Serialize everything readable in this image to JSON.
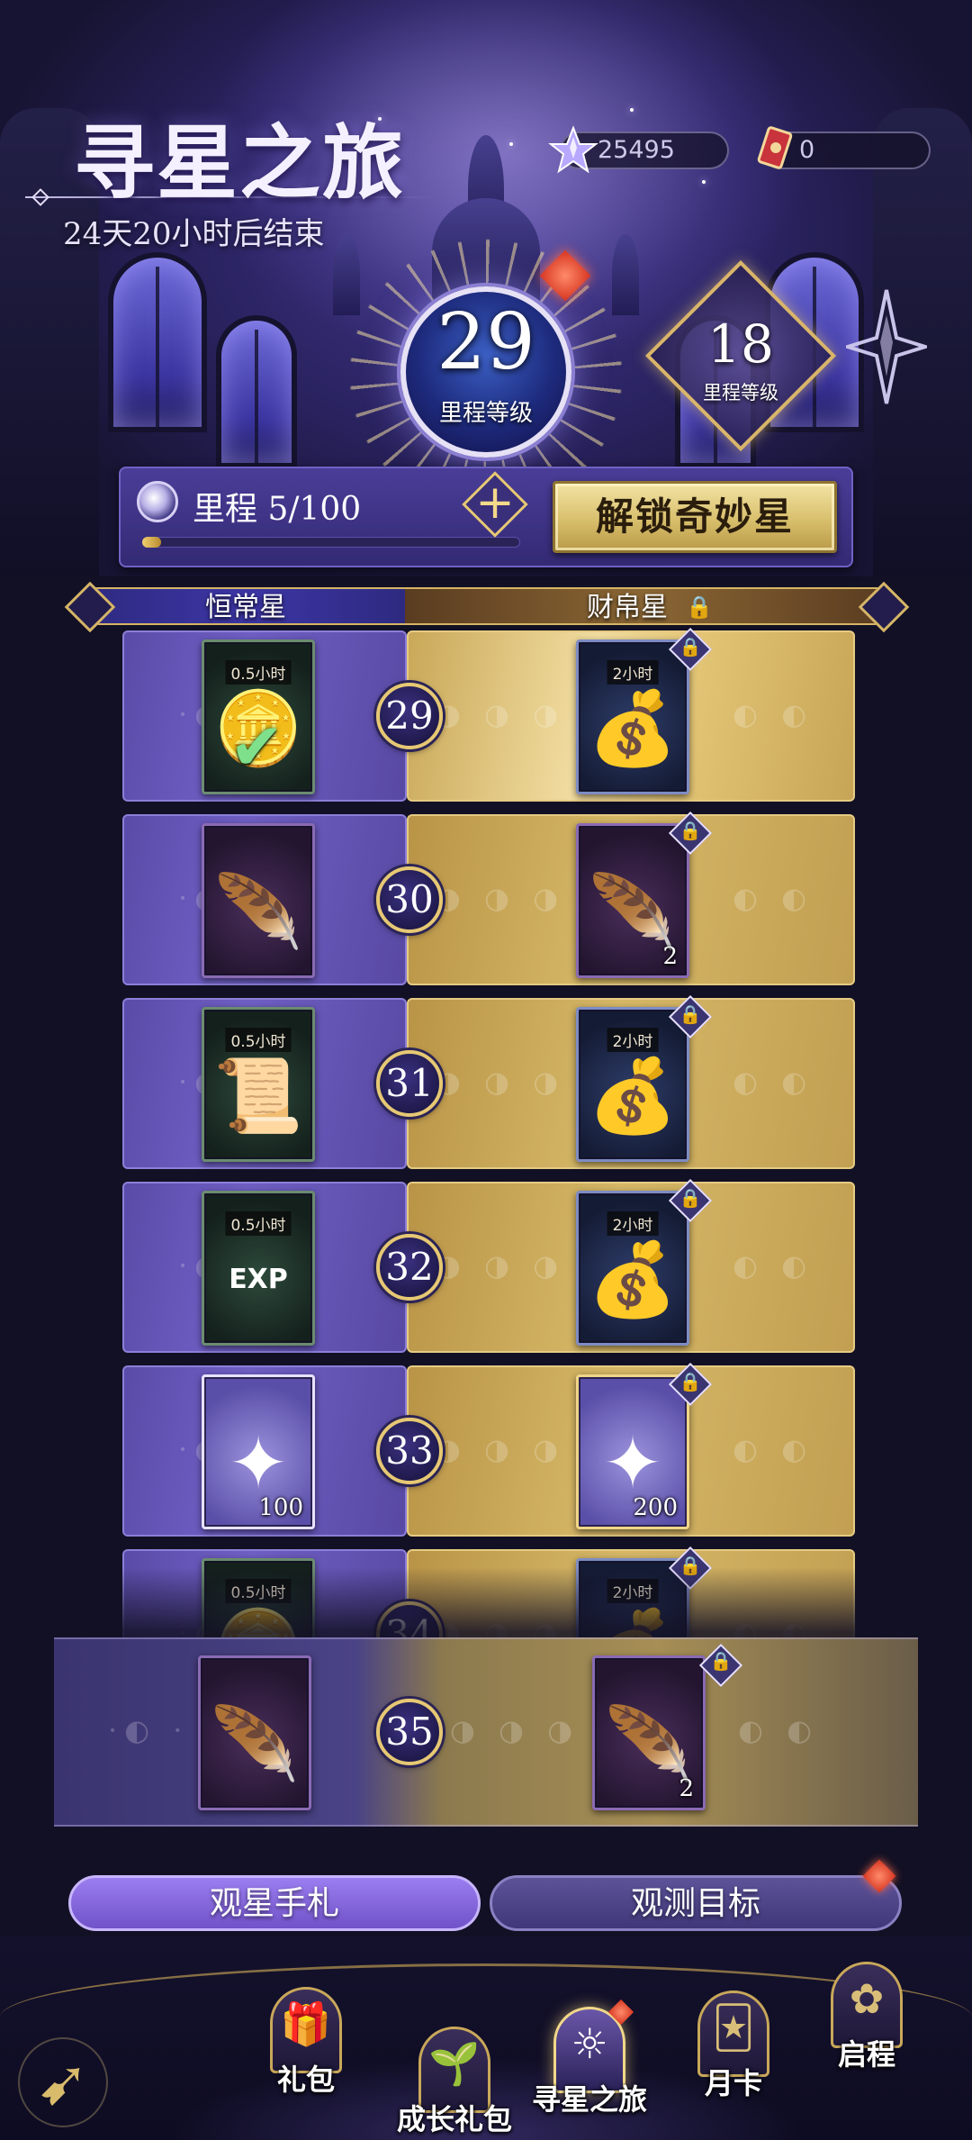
{
  "header": {
    "title": "寻星之旅",
    "countdown": "24天20小时后结束"
  },
  "currencies": [
    {
      "icon": "star-crystal-icon",
      "value": "25495"
    },
    {
      "icon": "ticket-card-icon",
      "value": "0"
    }
  ],
  "level": {
    "current": "29",
    "current_label": "里程等级",
    "next": "18",
    "next_label": "里程等级"
  },
  "mileage": {
    "label": "里程 5/100",
    "progress": 0.05,
    "plus": "+",
    "unlock_button": "解锁奇妙星"
  },
  "tracks": {
    "free": "恒常星",
    "paid": "财帛星"
  },
  "rows": [
    {
      "level": "29",
      "free": {
        "icon": "coin-stack-icon",
        "tag": "0.5小时",
        "qty": "",
        "style": "green",
        "claimed": true
      },
      "paid": {
        "icon": "treasure-bag-icon",
        "tag": "2小时",
        "qty": "",
        "style": "navy"
      }
    },
    {
      "level": "30",
      "free": {
        "icon": "golden-feather-icon",
        "tag": "",
        "qty": "",
        "style": "purple",
        "claimed": false
      },
      "paid": {
        "icon": "golden-feather-icon",
        "tag": "",
        "qty": "2",
        "style": "purple"
      }
    },
    {
      "level": "31",
      "free": {
        "icon": "scroll-icon",
        "tag": "0.5小时",
        "qty": "",
        "style": "green",
        "claimed": false
      },
      "paid": {
        "icon": "scroll-bag-icon",
        "tag": "2小时",
        "qty": "",
        "style": "navy"
      }
    },
    {
      "level": "32",
      "free": {
        "icon": "exp-orb-icon",
        "tag": "0.5小时",
        "qty": "",
        "style": "green",
        "claimed": false
      },
      "paid": {
        "icon": "exp-bag-icon",
        "tag": "2小时",
        "qty": "",
        "style": "navy"
      }
    },
    {
      "level": "33",
      "free": {
        "icon": "star-crystal-icon",
        "tag": "",
        "qty": "100",
        "style": "crystal",
        "claimed": false
      },
      "paid": {
        "icon": "star-crystal-icon",
        "tag": "",
        "qty": "200",
        "style": "crystal"
      }
    },
    {
      "level": "34",
      "free": {
        "icon": "reward-icon",
        "tag": "0.5小时",
        "qty": "",
        "style": "green",
        "claimed": false
      },
      "paid": {
        "icon": "reward-bag-icon",
        "tag": "2小时",
        "qty": "",
        "style": "navy"
      }
    }
  ],
  "preview": {
    "level": "35",
    "free": {
      "icon": "golden-feather-icon",
      "qty": ""
    },
    "paid": {
      "icon": "golden-feather-icon",
      "qty": "2"
    }
  },
  "actions": {
    "diary": "观星手札",
    "target": "观测目标"
  },
  "nav": [
    {
      "label": "礼包",
      "icon": "gift-icon"
    },
    {
      "label": "成长礼包",
      "icon": "seedling-icon"
    },
    {
      "label": "寻星之旅",
      "icon": "star-sun-icon"
    },
    {
      "label": "月卡",
      "icon": "cards-icon"
    },
    {
      "label": "启程",
      "icon": "rose-icon"
    }
  ],
  "colors": {
    "accent_gold": "#e6c874",
    "free_track": "#6f5fc4",
    "paid_track": "#d5b767",
    "notify_red": "#d63520"
  }
}
